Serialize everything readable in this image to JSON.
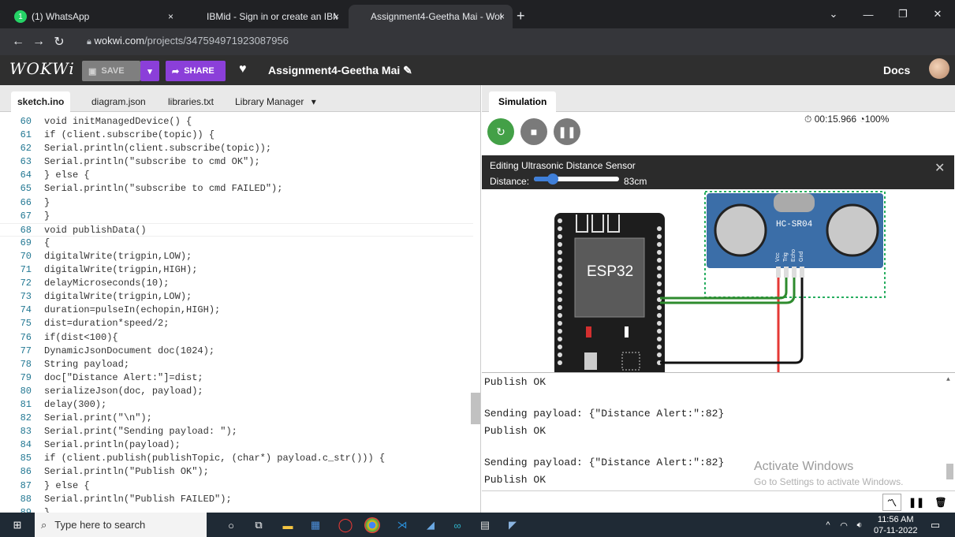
{
  "browser": {
    "tabs": [
      {
        "title": "(1) WhatsApp",
        "badge": "1",
        "close": "×"
      },
      {
        "title": "IBMid - Sign in or create an IBMid",
        "close": "×"
      },
      {
        "title": "Assignment4-Geetha Mai - Wokwi",
        "close": "×"
      }
    ],
    "new_tab": "+",
    "url_host": "wokwi.com",
    "url_path": "/projects/347594971923087956"
  },
  "wokwi": {
    "logo": "WOKWi",
    "save_label": "SAVE",
    "share_label": "SHARE",
    "project_name": "Assignment4-Geetha Mai",
    "docs_label": "Docs",
    "editor_tabs": [
      "sketch.ino",
      "diagram.json",
      "libraries.txt",
      "Library Manager"
    ],
    "code_lines": [
      {
        "n": "60",
        "t": "void initManagedDevice() {"
      },
      {
        "n": "61",
        "t": "if (client.subscribe(topic)) {"
      },
      {
        "n": "62",
        "t": "Serial.println(client.subscribe(topic));"
      },
      {
        "n": "63",
        "t": "Serial.println(\"subscribe to cmd OK\");"
      },
      {
        "n": "64",
        "t": "} else {"
      },
      {
        "n": "65",
        "t": "Serial.println(\"subscribe to cmd FAILED\");"
      },
      {
        "n": "66",
        "t": "}"
      },
      {
        "n": "67",
        "t": "}"
      },
      {
        "n": "68",
        "t": "void publishData()"
      },
      {
        "n": "69",
        "t": "{"
      },
      {
        "n": "70",
        "t": "digitalWrite(trigpin,LOW);"
      },
      {
        "n": "71",
        "t": "digitalWrite(trigpin,HIGH);"
      },
      {
        "n": "72",
        "t": "delayMicroseconds(10);"
      },
      {
        "n": "73",
        "t": "digitalWrite(trigpin,LOW);"
      },
      {
        "n": "74",
        "t": "duration=pulseIn(echopin,HIGH);"
      },
      {
        "n": "75",
        "t": "dist=duration*speed/2;"
      },
      {
        "n": "76",
        "t": "if(dist<100){"
      },
      {
        "n": "77",
        "t": "DynamicJsonDocument doc(1024);"
      },
      {
        "n": "78",
        "t": "String payload;"
      },
      {
        "n": "79",
        "t": "doc[\"Distance Alert:\"]=dist;"
      },
      {
        "n": "80",
        "t": "serializeJson(doc, payload);"
      },
      {
        "n": "81",
        "t": "delay(300);"
      },
      {
        "n": "82",
        "t": "Serial.print(\"\\n\");"
      },
      {
        "n": "83",
        "t": "Serial.print(\"Sending payload: \");"
      },
      {
        "n": "84",
        "t": "Serial.println(payload);"
      },
      {
        "n": "85",
        "t": "if (client.publish(publishTopic, (char*) payload.c_str())) {"
      },
      {
        "n": "86",
        "t": "Serial.println(\"Publish OK\");"
      },
      {
        "n": "87",
        "t": "} else {"
      },
      {
        "n": "88",
        "t": "Serial.println(\"Publish FAILED\");"
      },
      {
        "n": "89",
        "t": "}"
      }
    ],
    "simulation_tab": "Simulation",
    "timer": "00:15.966",
    "speed": "100%",
    "edit_panel": {
      "title": "Editing Ultrasonic Distance Sensor",
      "distance_label": "Distance:",
      "distance_value": "83cm",
      "slider_fraction": 0.22
    },
    "board_label": "ESP32",
    "sensor_label": "HC-SR04",
    "sensor_pins": [
      "Vcc",
      "Trig",
      "Echo",
      "Gnd"
    ],
    "serial_lines": [
      "Publish OK",
      "",
      "Sending payload: {\"Distance Alert:\":82}",
      "Publish OK",
      "",
      "Sending payload: {\"Distance Alert:\":82}",
      "Publish OK"
    ],
    "activate_title": "Activate Windows",
    "activate_sub": "Go to Settings to activate Windows."
  },
  "taskbar": {
    "search_placeholder": "Type here to search",
    "time": "11:56 AM",
    "date": "07-11-2022"
  }
}
